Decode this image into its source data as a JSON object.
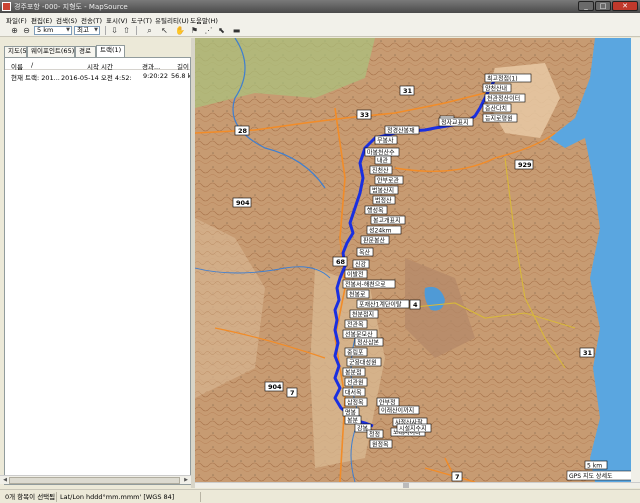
{
  "window": {
    "title": "경주포항 -000- 지형도 - MapSource"
  },
  "menu": [
    "파일(F)",
    "편집(E)",
    "검색(S)",
    "전송(T)",
    "표시(V)",
    "도구(T)",
    "유틸리티(U)",
    "도움말(H)"
  ],
  "toolbar": {
    "zoom_value": "5 km",
    "detail_value": "최고"
  },
  "tabs": [
    "지도(5)",
    "웨이포인트(65)",
    "경로",
    "트랙(1)"
  ],
  "active_tab": "트랙(1)",
  "track_table": {
    "columns": [
      "이름",
      "/",
      "시작 시간",
      "경과...",
      "길이"
    ],
    "rows": [
      {
        "name": "현재 트랙: 201...",
        "start": "2016-05-14 오전 4:52:26",
        "elapsed": "9:20:22",
        "length": "56.8 k"
      }
    ]
  },
  "status": {
    "selection": "0개 항목이 선택됨",
    "coord_format": "Lat/Lon hddd°mm.mmm' [WGS 84]"
  },
  "map": {
    "scale_text": "5 km",
    "map_name": "GPS 지도 상세도",
    "road_numbers": [
      "31",
      "28",
      "33",
      "20",
      "929",
      "904",
      "904",
      "4",
      "31",
      "7",
      "68",
      "7"
    ],
    "waypoints": [
      "최고정점(1)",
      "양천산내",
      "천관정산이터",
      "증산다치",
      "능지로평원",
      "정자교표지",
      "정경산봉재",
      "무봉사",
      "마봉천산수",
      "내관",
      "진천산",
      "안부로관",
      "범봉산지",
      "범정산",
      "행성목",
      "봉고개표지",
      "성24km",
      "판문봉산",
      "옥산",
      "신강",
      "이발전",
      "전봉서-해천으로",
      "천봉로",
      "포재산1계단이탈",
      "천분점지",
      "전관목",
      "선봉문모산",
      "정산삼본",
      "중림포",
      "군용대성원",
      "봉분점",
      "선관원",
      "대서목",
      "삼정목",
      "명봉",
      "봉분",
      "강봉",
      "청정",
      "원정목",
      "안부정",
      "노래사이다",
      "이래산이까지",
      "사정산사찰",
      "시설지수지"
    ]
  },
  "colors": {
    "track": "#1a2fe0",
    "sea": "#5aa6e0",
    "terrain": "#c9a27e"
  }
}
